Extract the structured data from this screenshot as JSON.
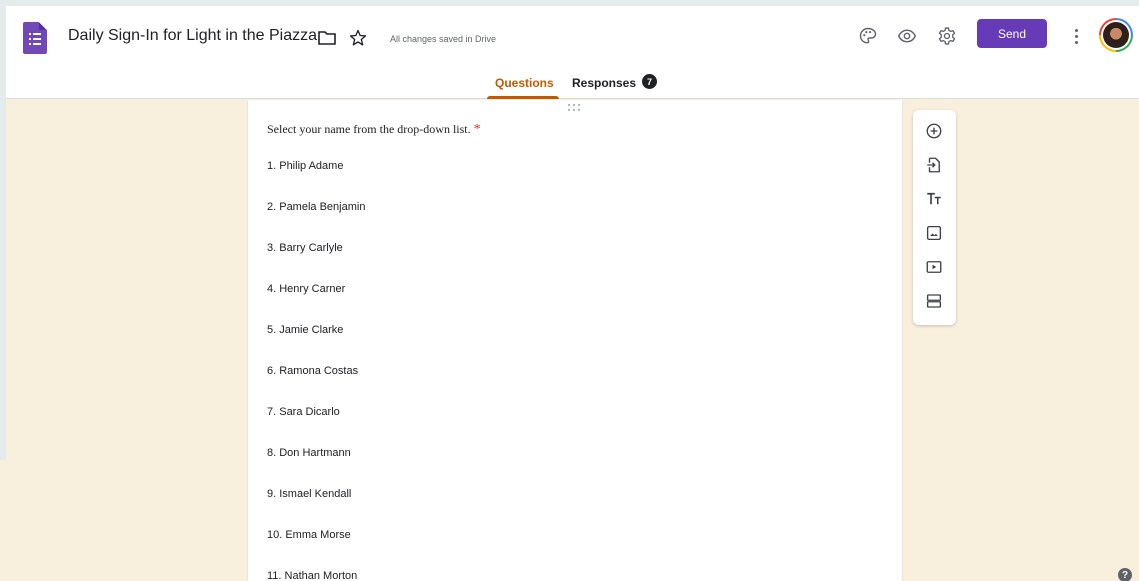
{
  "header": {
    "title": "Daily Sign-In for Light in the Piazza",
    "save_status": "All changes saved in Drive",
    "send_label": "Send",
    "icons": [
      "forms-logo-icon",
      "folder-icon",
      "star-icon",
      "palette-icon",
      "eye-icon",
      "gear-icon",
      "more-vert-icon"
    ]
  },
  "tabs": {
    "questions": "Questions",
    "responses": "Responses",
    "responses_count": "7"
  },
  "question": {
    "title": "Select your name from the drop-down list.",
    "required_mark": "*",
    "options": [
      "1.  Philip Adame",
      "2.  Pamela Benjamin",
      "3.  Barry Carlyle",
      "4.  Henry Carner",
      "5.  Jamie Clarke",
      "6.  Ramona Costas",
      "7.  Sara Dicarlo",
      "8.  Don Hartmann",
      "9.  Ismael Kendall",
      "10.  Emma Morse",
      "11.  Nathan Morton"
    ]
  },
  "toolbar": {
    "icons": [
      "add-question-icon",
      "import-questions-icon",
      "add-title-icon",
      "add-image-icon",
      "add-video-icon",
      "add-section-icon"
    ]
  },
  "colors": {
    "brand": "#673ab7",
    "accent_tab": "#c05a00",
    "background": "#f8efdc",
    "required": "#d93025"
  },
  "help_label": "?"
}
